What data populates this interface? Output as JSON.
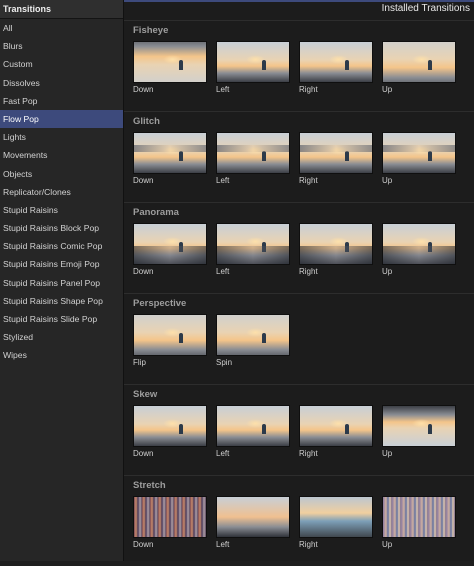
{
  "sidebar": {
    "header": "Transitions",
    "items": [
      "All",
      "Blurs",
      "Custom",
      "Dissolves",
      "Fast Pop",
      "Flow Pop",
      "Lights",
      "Movements",
      "Objects",
      "Replicator/Clones",
      "Stupid Raisins",
      "Stupid Raisins Block Pop",
      "Stupid Raisins Comic Pop",
      "Stupid Raisins Emoji Pop",
      "Stupid Raisins Panel Pop",
      "Stupid Raisins Shape Pop",
      "Stupid Raisins Slide Pop",
      "Stylized",
      "Wipes"
    ],
    "selected": "Flow Pop"
  },
  "main": {
    "header": "Installed Transitions",
    "sections": [
      {
        "title": "Fisheye",
        "tiles": [
          "Down",
          "Left",
          "Right",
          "Up"
        ]
      },
      {
        "title": "Glitch",
        "tiles": [
          "Down",
          "Left",
          "Right",
          "Up"
        ]
      },
      {
        "title": "Panorama",
        "tiles": [
          "Down",
          "Left",
          "Right",
          "Up"
        ]
      },
      {
        "title": "Perspective",
        "tiles": [
          "Flip",
          "Spin"
        ]
      },
      {
        "title": "Skew",
        "tiles": [
          "Down",
          "Left",
          "Right",
          "Up"
        ]
      },
      {
        "title": "Stretch",
        "tiles": [
          "Down",
          "Left",
          "Right",
          "Up"
        ]
      }
    ]
  },
  "colors": {
    "selection": "#3d4a7c",
    "background": "#1c1c1c",
    "sidebar": "#262626"
  }
}
